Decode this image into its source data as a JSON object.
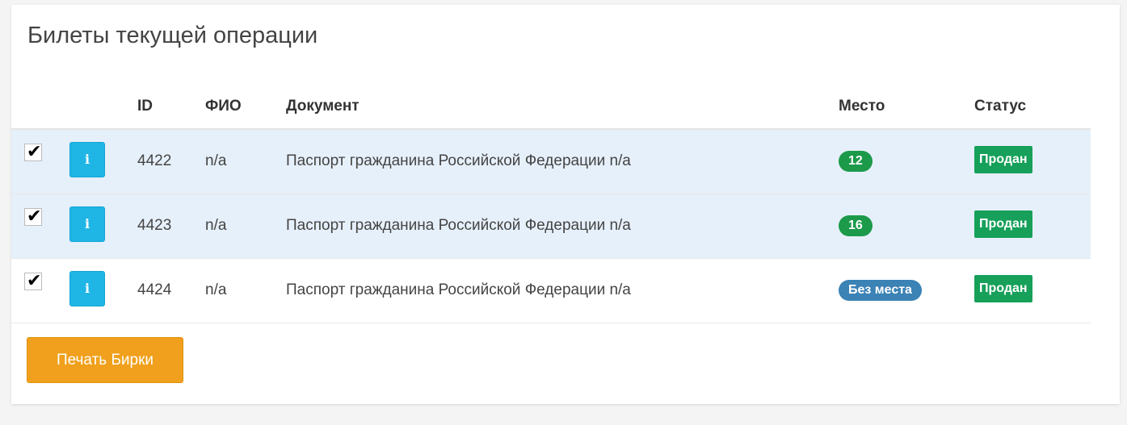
{
  "panel": {
    "title": "Билеты текущей операции"
  },
  "table": {
    "columns": {
      "id": "ID",
      "fio": "ФИО",
      "document": "Документ",
      "place": "Место",
      "status": "Статус"
    },
    "rows": [
      {
        "checked": true,
        "info_icon": "i",
        "id": "4422",
        "fio": "n/a",
        "document": "Паспорт гражданина Российской Федерации n/a",
        "place": "12",
        "status": "Продан"
      },
      {
        "checked": true,
        "info_icon": "i",
        "id": "4423",
        "fio": "n/a",
        "document": "Паспорт гражданина Российской Федерации n/a",
        "place": "16",
        "status": "Продан"
      },
      {
        "checked": true,
        "info_icon": "i",
        "id": "4424",
        "fio": "n/a",
        "document": "Паспорт гражданина Российской Федерации n/a",
        "place": "Без места",
        "status": "Продан"
      }
    ]
  },
  "actions": {
    "print_label": "Печать Бирки"
  },
  "colors": {
    "info_button": "#1fb5e5",
    "seat_badge": "#1c9a4a",
    "no_seat_badge": "#3b82b5",
    "status_sold": "#16a05a",
    "print_button": "#f0a01c",
    "selected_row": "#e6f0fa"
  },
  "icons": {
    "checkbox": "check-icon",
    "info": "info-icon"
  }
}
